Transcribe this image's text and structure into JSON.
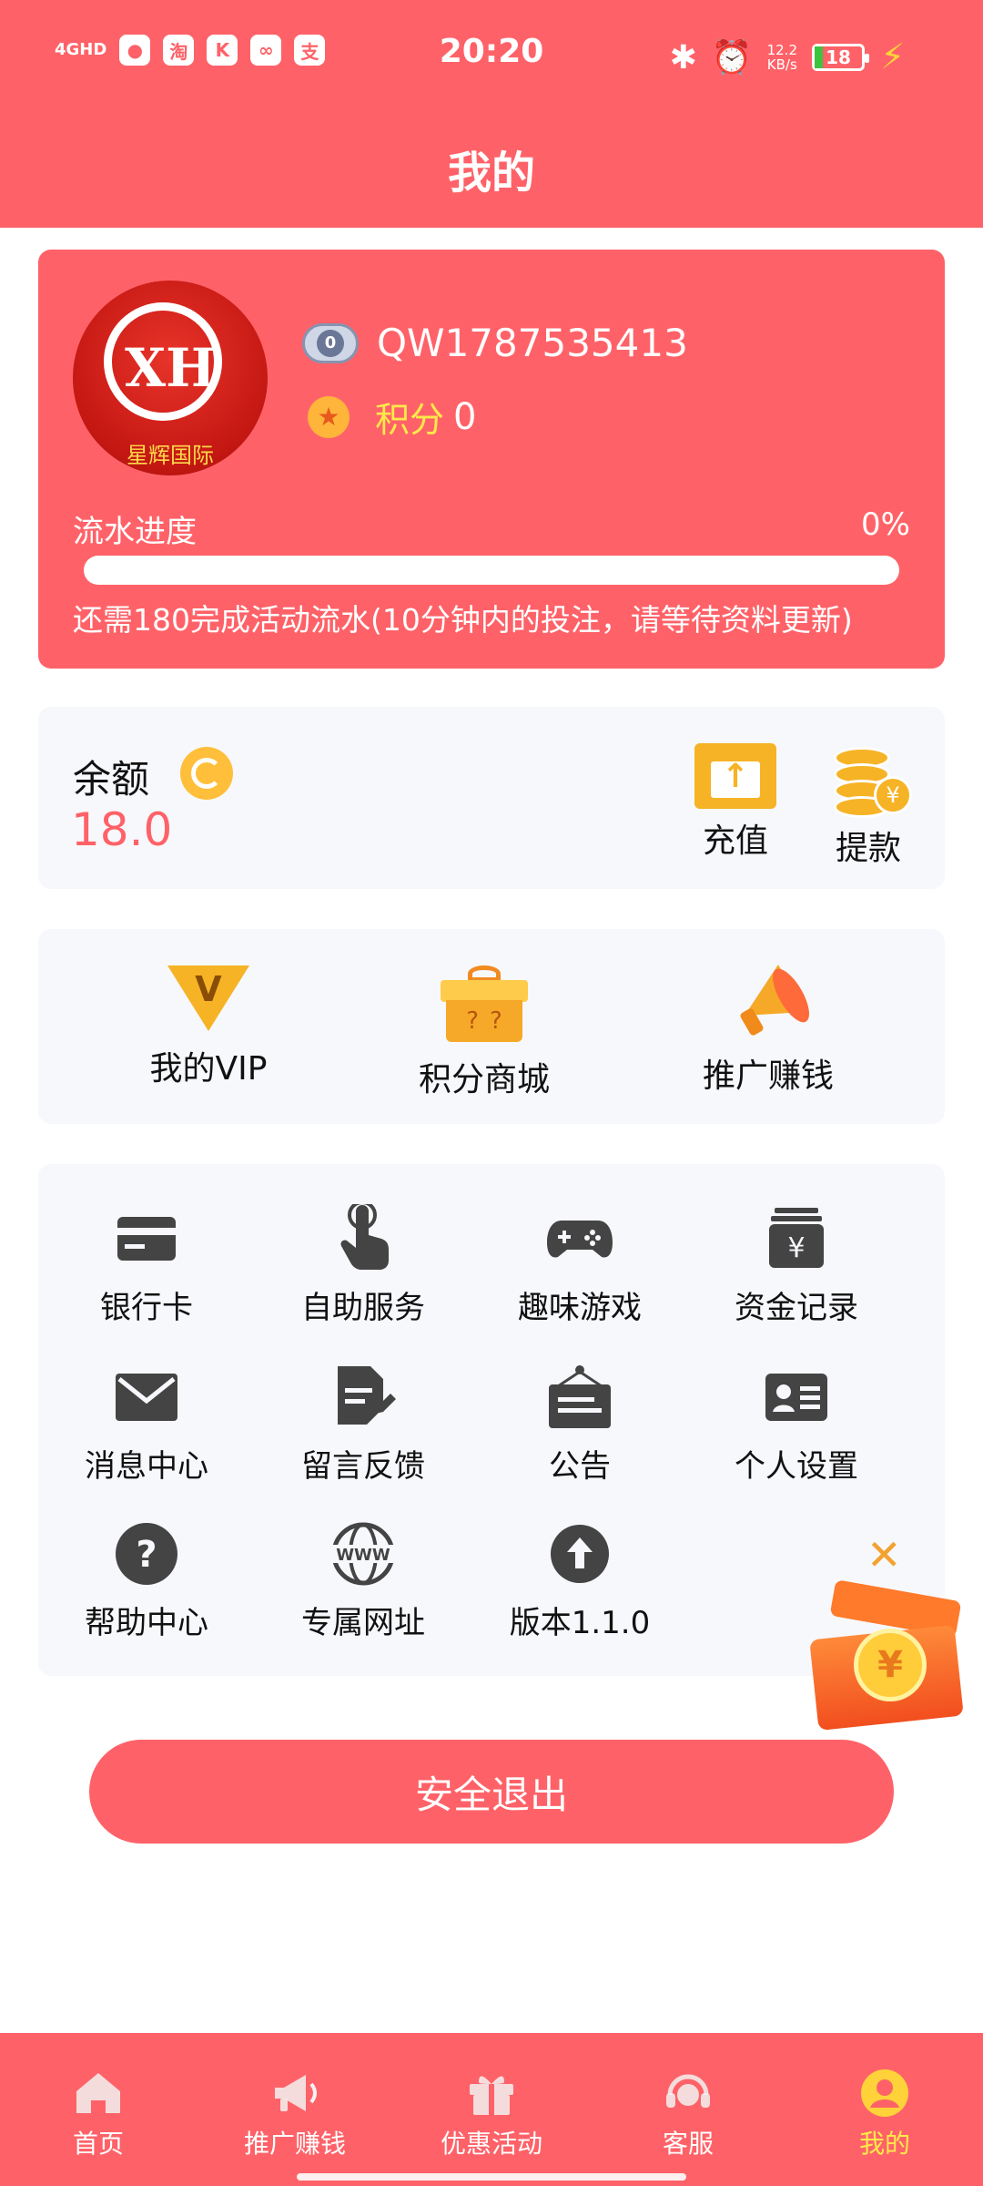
{
  "status_bar": {
    "network": "4GHD",
    "app_icons": [
      "淘",
      "K",
      "支"
    ],
    "time": "20:20",
    "speed_value": "12.2",
    "speed_unit": "KB/s",
    "battery": "18",
    "battery_level_percent": 18
  },
  "header": {
    "title": "我的"
  },
  "profile": {
    "avatar_monogram": "XH",
    "avatar_banner": "星辉国际",
    "level_badge": "0",
    "username": "QW1787535413",
    "points_label": "积分",
    "points_value": "0",
    "progress_label": "流水进度",
    "progress_percent_text": "0%",
    "progress_fraction": 0,
    "progress_note": "还需180完成活动流水(10分钟内的投注，请等待资料更新)"
  },
  "balance": {
    "label": "余额",
    "value": "18.0",
    "recharge_label": "充值",
    "withdraw_label": "提款",
    "withdraw_coin_symbol": "¥"
  },
  "quick_actions": [
    {
      "label": "我的VIP",
      "icon": "vip-diamond-icon"
    },
    {
      "label": "积分商城",
      "icon": "gift-box-icon"
    },
    {
      "label": "推广赚钱",
      "icon": "megaphone-icon"
    }
  ],
  "menu_grid": [
    {
      "label": "银行卡",
      "icon": "bank-card-icon"
    },
    {
      "label": "自助服务",
      "icon": "hand-pointer-icon"
    },
    {
      "label": "趣味游戏",
      "icon": "gamepad-icon"
    },
    {
      "label": "资金记录",
      "icon": "money-record-icon"
    },
    {
      "label": "消息中心",
      "icon": "envelope-icon"
    },
    {
      "label": "留言反馈",
      "icon": "feedback-icon"
    },
    {
      "label": "公告",
      "icon": "notice-board-icon"
    },
    {
      "label": "个人设置",
      "icon": "id-card-icon"
    },
    {
      "label": "帮助中心",
      "icon": "help-icon"
    },
    {
      "label": "专属网址",
      "icon": "www-globe-icon"
    },
    {
      "label": "版本1.1.0",
      "icon": "upload-arrow-icon"
    }
  ],
  "logout_label": "安全退出",
  "tabbar": [
    {
      "label": "首页",
      "icon": "home-icon"
    },
    {
      "label": "推广赚钱",
      "icon": "megaphone-icon"
    },
    {
      "label": "优惠活动",
      "icon": "gift-icon"
    },
    {
      "label": "客服",
      "icon": "headset-icon"
    },
    {
      "label": "我的",
      "icon": "user-icon",
      "active": true
    }
  ],
  "colors": {
    "primary": "#fe6268",
    "accent_yellow": "#ffe94a",
    "gold": "#f6b325",
    "card_bg": "#f7f8fc",
    "icon_dark": "#444444"
  }
}
